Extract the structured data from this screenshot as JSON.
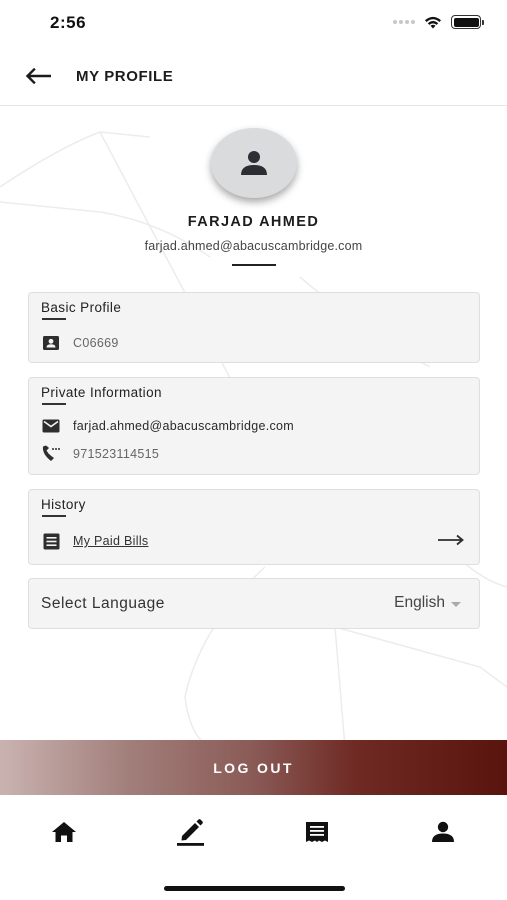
{
  "status_bar": {
    "time": "2:56",
    "icons": [
      "signal-icon",
      "wifi-icon",
      "battery-icon"
    ]
  },
  "header": {
    "title": "MY PROFILE",
    "back_icon": "arrow-left-icon"
  },
  "profile": {
    "avatar_icon": "person-icon",
    "name": "FARJAD AHMED",
    "email": "farjad.ahmed@abacuscambridge.com"
  },
  "basic_profile": {
    "title": "Basic Profile",
    "id_icon": "contact-card-icon",
    "id_value": "C06669"
  },
  "private_information": {
    "title": "Private Information",
    "email_icon": "mail-icon",
    "email": "farjad.ahmed@abacuscambridge.com",
    "phone_icon": "phone-icon",
    "phone": "971523114515"
  },
  "history": {
    "title": "History",
    "bills_icon": "receipt-list-icon",
    "bills_label": "My Paid Bills",
    "arrow_icon": "arrow-right-icon"
  },
  "language": {
    "label": "Select Language",
    "selected": "English",
    "caret_icon": "caret-down-icon"
  },
  "logout": {
    "label": "LOG OUT"
  },
  "bottom_nav": {
    "items": [
      {
        "name": "home",
        "icon": "home-icon"
      },
      {
        "name": "edit",
        "icon": "pencil-icon"
      },
      {
        "name": "bills",
        "icon": "receipt-icon"
      },
      {
        "name": "profile",
        "icon": "person-icon"
      }
    ]
  },
  "colors": {
    "logout_gradient_start": "#c9b3b1",
    "logout_gradient_end": "#5a140e",
    "card_background": "#f4f4f4"
  }
}
